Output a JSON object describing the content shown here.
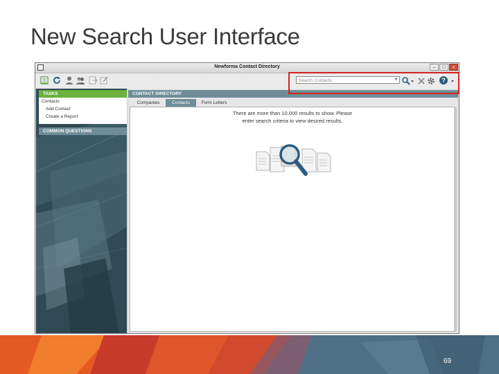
{
  "slide": {
    "title": "New Search User Interface",
    "page_number": "69"
  },
  "window": {
    "title": "Newforma Contact Directory",
    "minimize": "–",
    "maximize": "□",
    "close": "x"
  },
  "toolbar": {
    "search_placeholder": "Search Contacts",
    "icons": [
      "new-contact-icon",
      "refresh-icon",
      "person-icon",
      "group-icon",
      "export-icon",
      "edit-icon",
      "search-icon",
      "clear-icon",
      "settings-icon",
      "help-icon"
    ]
  },
  "sidebar": {
    "tasks_header": "TASKS",
    "items": [
      "Contacts",
      "Add Contact",
      "Create a Report"
    ],
    "common_header": "COMMON QUESTIONS"
  },
  "main": {
    "header": "CONTACT DIRECTORY",
    "tabs": [
      "Companies",
      "Contacts",
      "Form Letters"
    ],
    "active_tab": "Contacts",
    "message_line1": "There are more than 10,000 results to show. Please",
    "message_line2": "enter search criteria to view desired results."
  },
  "colors": {
    "tasks_green": "#6ab23d",
    "header_slate": "#6e8d97",
    "highlight_red": "#d42020",
    "sidebar_dark": "#2c4651"
  }
}
